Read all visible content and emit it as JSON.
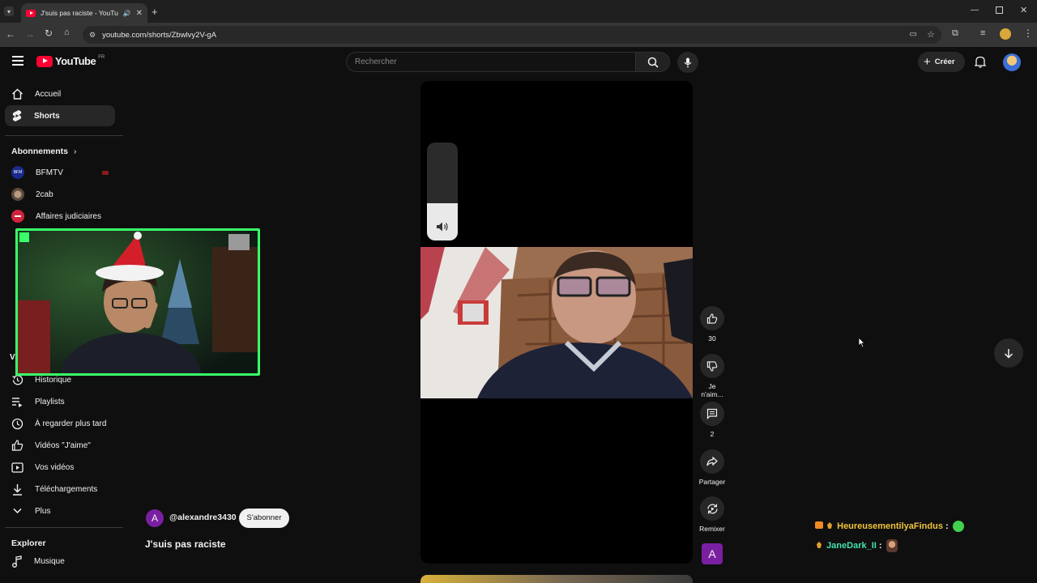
{
  "browser": {
    "tab_title": "J'suis pas raciste - YouTube",
    "url": "youtube.com/shorts/Zbwlvy2V-gA"
  },
  "header": {
    "logo_text": "YouTube",
    "country": "FR",
    "search_placeholder": "Rechercher",
    "create_label": "Créer"
  },
  "sidebar": {
    "nav": [
      {
        "label": "Accueil",
        "icon": "home-icon"
      },
      {
        "label": "Shorts",
        "icon": "shorts-icon"
      }
    ],
    "subscriptions_title": "Abonnements",
    "subscriptions": [
      {
        "label": "BFMTV",
        "color": "#1b2a8a"
      },
      {
        "label": "2cab",
        "color": "#6f5a4a"
      },
      {
        "label": "Affaires judiciaires",
        "color": "#d0243a"
      }
    ],
    "you_items": [
      {
        "label": "Historique",
        "icon": "history-icon"
      },
      {
        "label": "Playlists",
        "icon": "playlist-icon"
      },
      {
        "label": "À regarder plus tard",
        "icon": "clock-icon"
      },
      {
        "label": "Vidéos \"J'aime\"",
        "icon": "thumb-up-icon"
      },
      {
        "label": "Vos vidéos",
        "icon": "video-icon"
      },
      {
        "label": "Téléchargements",
        "icon": "download-icon"
      },
      {
        "label": "Plus",
        "icon": "chevron-down-icon"
      }
    ],
    "explore_title": "Explorer",
    "explore_items": [
      {
        "label": "Musique",
        "icon": "music-icon"
      }
    ],
    "user_section_letter": "V"
  },
  "short": {
    "channel_handle": "@alexandre3430",
    "channel_initial": "A",
    "subscribe_label": "S'abonner",
    "title": "J'suis pas raciste",
    "volume_level": 0.38
  },
  "actions": {
    "likes": "30",
    "dislike_label": "Je n'aim...",
    "comments": "2",
    "share_label": "Partager",
    "remix_label": "Remixer",
    "avatar_initial": "A"
  },
  "chat": [
    {
      "user": "HeureusementilyaFindus",
      "sep": ":",
      "color": "#f0c43c"
    },
    {
      "user": "JaneDark_II",
      "sep": ":",
      "color": "#45e0b0"
    }
  ],
  "colors": {
    "accent": "#ff0033",
    "overlay_border": "#39ff6a",
    "channel_avatar": "#7b1fa2"
  }
}
